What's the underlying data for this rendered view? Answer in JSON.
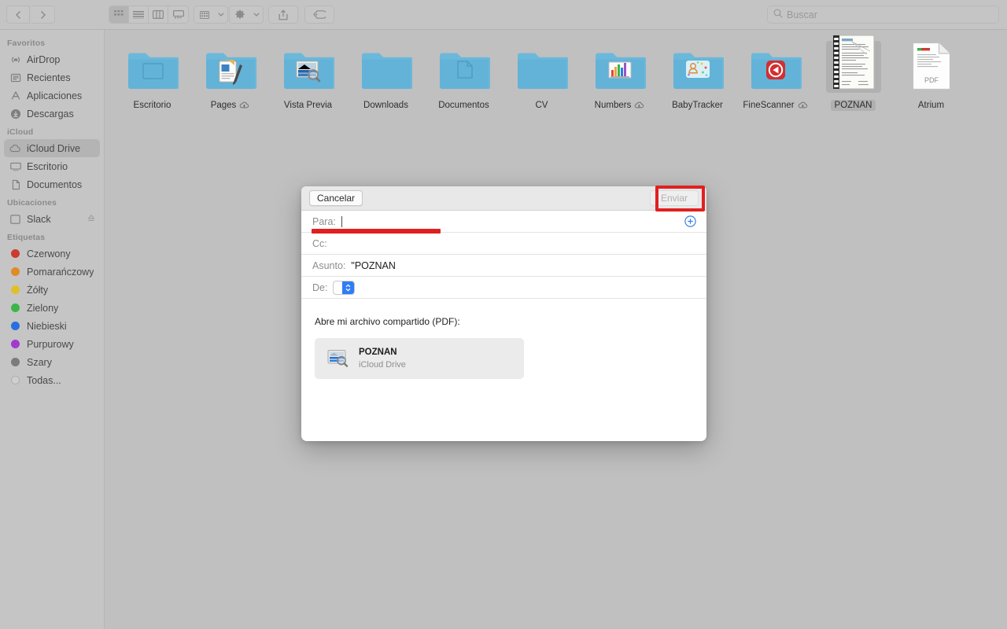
{
  "window": {
    "background_color": "#c0c0c0"
  },
  "toolbar": {
    "back_icon": "chevron-left-icon",
    "forward_icon": "chevron-right-icon",
    "view_modes": [
      {
        "name": "icon-view",
        "icon": "grid-icon",
        "active": true
      },
      {
        "name": "list-view",
        "icon": "list-icon",
        "active": false
      },
      {
        "name": "column-view",
        "icon": "columns-icon",
        "active": false
      },
      {
        "name": "gallery-view",
        "icon": "gallery-icon",
        "active": false
      }
    ],
    "group_by": {
      "name": "group-by",
      "icon": "grid-small-icon"
    },
    "action": {
      "name": "action-menu",
      "icon": "gear-icon"
    },
    "share": {
      "name": "share-button",
      "icon": "share-icon"
    },
    "tags": {
      "name": "tags-button",
      "icon": "tag-icon"
    }
  },
  "search": {
    "placeholder": "Buscar",
    "value": "",
    "icon": "search-icon"
  },
  "sidebar": {
    "sections": [
      {
        "title": "Favoritos",
        "items": [
          {
            "label": "AirDrop",
            "icon": "airdrop-icon",
            "selected": false,
            "eject": false
          },
          {
            "label": "Recientes",
            "icon": "recents-icon",
            "selected": false,
            "eject": false
          },
          {
            "label": "Aplicaciones",
            "icon": "applications-icon",
            "selected": false,
            "eject": false
          },
          {
            "label": "Descargas",
            "icon": "downloads-icon",
            "selected": false,
            "eject": false
          }
        ]
      },
      {
        "title": "iCloud",
        "items": [
          {
            "label": "iCloud Drive",
            "icon": "cloud-icon",
            "selected": true,
            "eject": false
          },
          {
            "label": "Escritorio",
            "icon": "desktop-icon",
            "selected": false,
            "eject": false
          },
          {
            "label": "Documentos",
            "icon": "documents-icon",
            "selected": false,
            "eject": false
          }
        ]
      },
      {
        "title": "Ubicaciones",
        "items": [
          {
            "label": "Slack",
            "icon": "disk-icon",
            "selected": false,
            "eject": true
          }
        ]
      },
      {
        "title": "Etiquetas",
        "items": [
          {
            "label": "Czerwony",
            "icon": "tag-dot-icon",
            "color": "#cc3b30",
            "selected": false,
            "eject": false
          },
          {
            "label": "Pomarańczowy",
            "icon": "tag-dot-icon",
            "color": "#e08a2a",
            "selected": false,
            "eject": false
          },
          {
            "label": "Żółty",
            "icon": "tag-dot-icon",
            "color": "#e0c02a",
            "selected": false,
            "eject": false
          },
          {
            "label": "Zielony",
            "icon": "tag-dot-icon",
            "color": "#3ab54a",
            "selected": false,
            "eject": false
          },
          {
            "label": "Niebieski",
            "icon": "tag-dot-icon",
            "color": "#2a6fe0",
            "selected": false,
            "eject": false
          },
          {
            "label": "Purpurowy",
            "icon": "tag-dot-icon",
            "color": "#a23ad0",
            "selected": false,
            "eject": false
          },
          {
            "label": "Szary",
            "icon": "tag-dot-icon",
            "color": "#7b7b7b",
            "selected": false,
            "eject": false
          },
          {
            "label": "Todas...",
            "icon": "tag-dot-hollow-icon",
            "color": "",
            "selected": false,
            "eject": false
          }
        ]
      }
    ]
  },
  "files": [
    {
      "name": "Escritorio",
      "kind": "folder",
      "glyph": "desktop",
      "cloud": false,
      "selected": false
    },
    {
      "name": "Pages",
      "kind": "folder",
      "glyph": "pages",
      "cloud": true,
      "selected": false
    },
    {
      "name": "Vista Previa",
      "kind": "folder",
      "glyph": "preview",
      "cloud": false,
      "selected": false
    },
    {
      "name": "Downloads",
      "kind": "folder",
      "glyph": "plain",
      "cloud": false,
      "selected": false
    },
    {
      "name": "Documentos",
      "kind": "folder",
      "glyph": "document",
      "cloud": false,
      "selected": false
    },
    {
      "name": "CV",
      "kind": "folder",
      "glyph": "plain",
      "cloud": false,
      "selected": false
    },
    {
      "name": "Numbers",
      "kind": "folder",
      "glyph": "numbers",
      "cloud": true,
      "selected": false
    },
    {
      "name": "BabyTracker",
      "kind": "folder",
      "glyph": "babytracker",
      "cloud": false,
      "selected": false
    },
    {
      "name": "FineScanner",
      "kind": "folder",
      "glyph": "finescanner",
      "cloud": true,
      "selected": false
    },
    {
      "name": "POZNAN",
      "kind": "scan",
      "glyph": "scan",
      "cloud": false,
      "selected": true
    },
    {
      "name": "Atrium",
      "kind": "pdf",
      "glyph": "pdf",
      "cloud": false,
      "selected": false
    }
  ],
  "mail_sheet": {
    "cancel_label": "Cancelar",
    "send_label": "Enviar",
    "send_enabled": false,
    "fields": [
      {
        "label": "Para:",
        "value": "",
        "focused": true
      },
      {
        "label": "Cc:",
        "value": "",
        "focused": false
      },
      {
        "label": "Asunto:",
        "value": "\"POZNAN",
        "focused": false
      }
    ],
    "from": {
      "label": "De:",
      "value": ""
    },
    "add_recipient_icon": "plus-circle-icon",
    "body_text": "Abre mi archivo compartido (PDF):",
    "attachment": {
      "title": "POZNAN",
      "subtitle": "iCloud Drive",
      "icon": "preview-document-icon"
    }
  },
  "annotations": {
    "color": "#e02020",
    "highlight_box_target": "Enviar",
    "underline_target": "Para:"
  },
  "pdf_badge_label": "PDF"
}
